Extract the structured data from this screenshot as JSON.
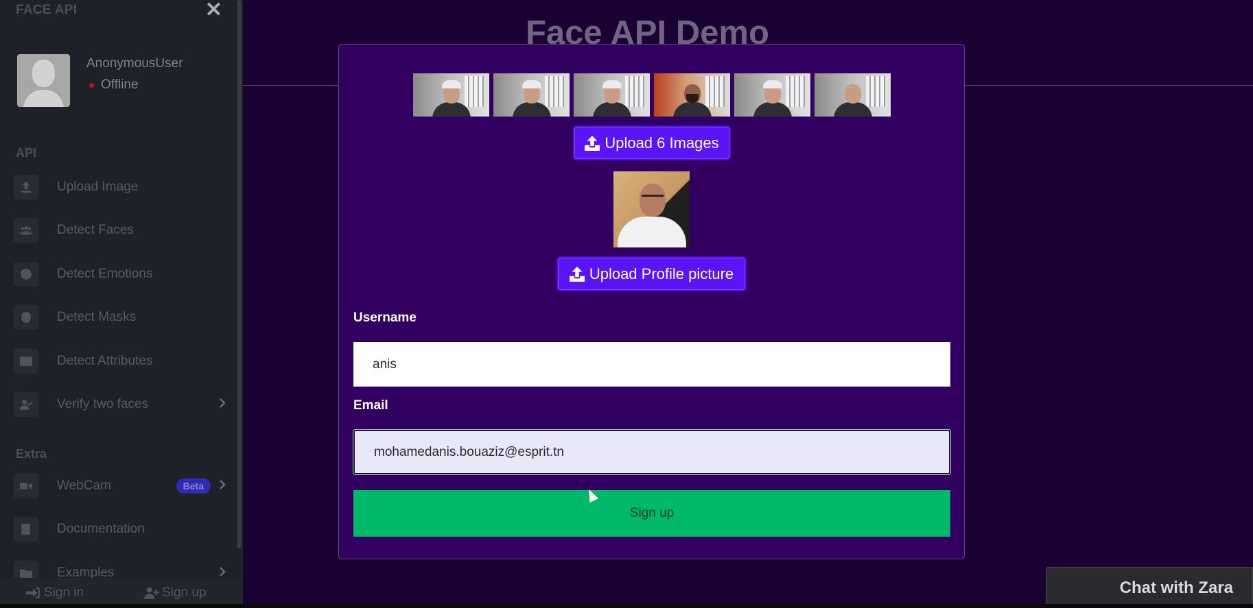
{
  "sidebar": {
    "brand": "FACE API",
    "user": {
      "name": "AnonymousUser",
      "status": "Offline"
    },
    "sections": {
      "api": "API",
      "extra": "Extra"
    },
    "api_items": [
      {
        "label": "Upload Image",
        "icon": "upload-icon"
      },
      {
        "label": "Detect Faces",
        "icon": "users-icon"
      },
      {
        "label": "Detect Emotions",
        "icon": "smile-icon"
      },
      {
        "label": "Detect Masks",
        "icon": "mask-icon"
      },
      {
        "label": "Detect Attributes",
        "icon": "id-card-icon"
      },
      {
        "label": "Verify two faces",
        "icon": "user-check-icon"
      }
    ],
    "extra_items": [
      {
        "label": "WebCam",
        "icon": "video-icon",
        "badge": "Beta"
      },
      {
        "label": "Documentation",
        "icon": "book-icon"
      },
      {
        "label": "Examples",
        "icon": "folder-icon"
      }
    ],
    "footer": {
      "signin": "Sign in",
      "signup": "Sign up"
    }
  },
  "main": {
    "title": "Face API Demo"
  },
  "modal": {
    "upload_images_label": "Upload 6 Images",
    "upload_profile_label": "Upload Profile picture",
    "username_label": "Username",
    "username_value": "anis",
    "email_label": "Email",
    "email_value": "mohamedanis.bouaziz@esprit.tn",
    "submit_label": "Sign up"
  },
  "chat": {
    "label": "Chat with Zara"
  },
  "colors": {
    "modal_bg": "#320060",
    "upload_button": "#5b14f5",
    "signup_button": "#00b869",
    "sidebar_bg": "#1e2127",
    "status_dot": "#c0131f"
  }
}
